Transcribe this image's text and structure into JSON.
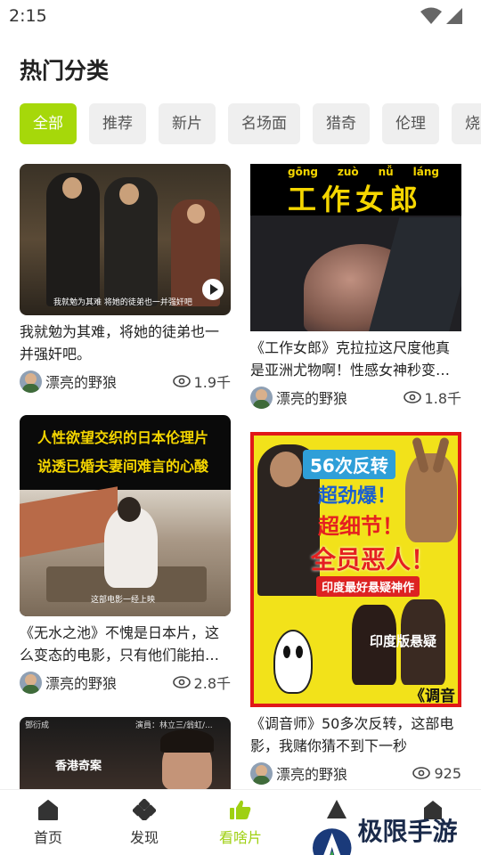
{
  "status": {
    "time": "2:15"
  },
  "page_title": "热门分类",
  "tabs": [
    "全部",
    "推荐",
    "新片",
    "名场面",
    "猎奇",
    "伦理",
    "烧"
  ],
  "cards": [
    {
      "title": "我就勉为其难，将她的徒弟也一并强奸吧。",
      "author": "漂亮的野狼",
      "views": "1.9千",
      "subtitle": "我就勉为其难 将她的徒弟也一并强奸吧"
    },
    {
      "title": "《工作女郎》克拉拉这尺度他真是亚洲尤物啊！性感女神秒变…",
      "author": "漂亮的野狼",
      "views": "1.8千",
      "overlay": "工作女郎",
      "pinyin": [
        "gōng",
        "zuò",
        "nǚ",
        "láng"
      ]
    },
    {
      "title": "《无水之池》不愧是日本片，这么变态的电影，只有他们能拍…",
      "author": "漂亮的野狼",
      "views": "2.8千",
      "overlay1": "人性欲望交织的日本伦理片",
      "overlay2": "说透已婚夫妻间难言的心酸",
      "subtitle": "这部电影一经上映"
    },
    {
      "title": "《调音师》50多次反转，这部电影，我赌你猜不到下一秒",
      "author": "漂亮的野狼",
      "views": "925",
      "overlay1": "56次反转",
      "overlay2": "超劲爆！",
      "overlay3": "超细节！",
      "overlay4": "全员恶人！",
      "overlay5": "印度最好悬疑神作",
      "overlay6": "印度版悬疑",
      "overlay7": "《调音"
    },
    {
      "overlay1": "香港奇案",
      "overlay2": "演員：林立三/翁虹/...",
      "overlay3": "鄧衍成"
    }
  ],
  "nav": [
    {
      "label": "首页",
      "icon": "home-icon"
    },
    {
      "label": "发现",
      "icon": "discover-icon"
    },
    {
      "label": "看啥片",
      "icon": "thumbs-up-icon"
    },
    {
      "label": "",
      "icon": "triangle-icon"
    },
    {
      "label": "",
      "icon": "profile-icon"
    }
  ],
  "watermark": "极限手游网",
  "colors": {
    "accent": "#a6d80a",
    "tab_bg": "#efefef"
  }
}
